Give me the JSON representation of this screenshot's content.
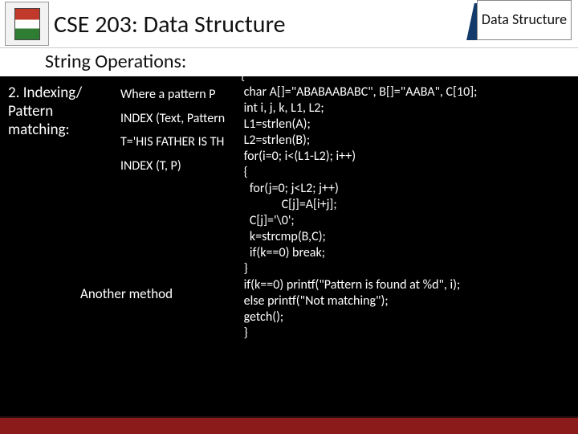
{
  "header": {
    "course_title": "CSE 203: Data Structure",
    "badge": "Data Structure"
  },
  "subheader": "String Operations:",
  "left": {
    "item": "2. Indexing/ Pattern matching:"
  },
  "mid": {
    "line1": "Where a pattern P",
    "line2": "INDEX (Text, Pattern",
    "line3": "T='HIS FATHER IS TH",
    "line4": "INDEX (T, P)",
    "another": "Another method"
  },
  "code": {
    "text": "main()\n{\n char A[]=\"ABABAABABC\", B[]=\"AABA\", C[10];\n int i, j, k, L1, L2;\n L1=strlen(A);\n L2=strlen(B);\n for(i=0; i<(L1-L2); i++)\n {\n   for(j=0; j<L2; j++)\n              C[j]=A[i+j];\n   C[j]='\\0';\n   k=strcmp(B,C);\n   if(k==0) break;\n }\n if(k==0) printf(\"Pattern is found at %d\", i);\n else printf(\"Not matching\");\n getch();\n }"
  }
}
